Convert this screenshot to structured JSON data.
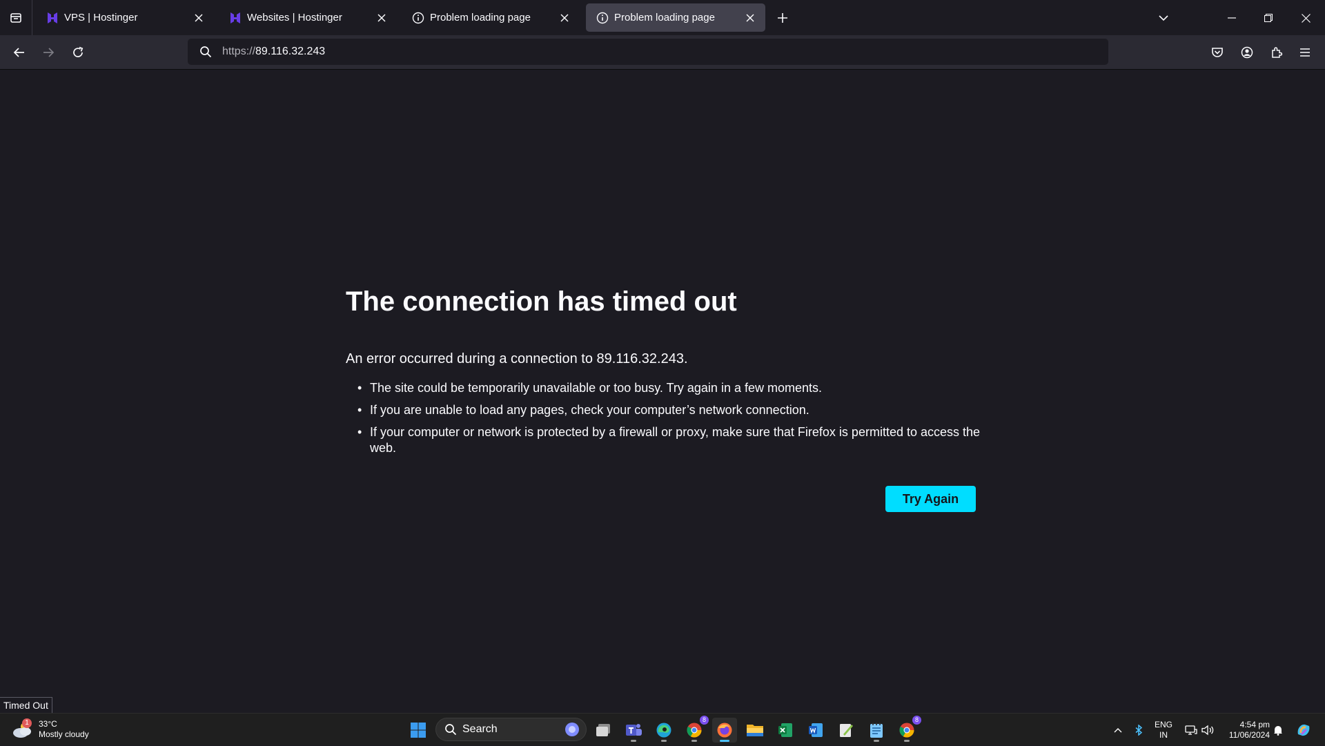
{
  "browser": {
    "tabs": [
      {
        "title": "VPS | Hostinger",
        "favicon": "hostinger-icon",
        "active": false
      },
      {
        "title": "Websites | Hostinger",
        "favicon": "hostinger-icon",
        "active": false
      },
      {
        "title": "Problem loading page",
        "favicon": "info-icon",
        "active": false
      },
      {
        "title": "Problem loading page",
        "favicon": "info-icon",
        "active": true
      }
    ],
    "url_scheme": "https://",
    "url_host": "89.116.32.243"
  },
  "error_page": {
    "title": "The connection has timed out",
    "intro": "An error occurred during a connection to 89.116.32.243.",
    "bullets": [
      "The site could be temporarily unavailable or too busy. Try again in a few moments.",
      "If you are unable to load any pages, check your computer’s network connection.",
      "If your computer or network is protected by a firewall or proxy, make sure that Firefox is permitted to access the web."
    ],
    "button_label": "Try Again"
  },
  "status_tooltip": "Timed Out",
  "taskbar": {
    "weather": {
      "badge": "1",
      "temp": "33°C",
      "condition": "Mostly cloudy"
    },
    "search_placeholder": "Search",
    "apps": [
      "task-view",
      "teams",
      "edge",
      "chrome",
      "firefox",
      "file-explorer",
      "excel",
      "word",
      "notepad-plus",
      "notepad",
      "chrome-profile"
    ],
    "chrome_badge": "8",
    "chrome_profile_badge": "8",
    "language": {
      "line1": "ENG",
      "line2": "IN"
    },
    "clock": {
      "time": "4:54 pm",
      "date": "11/06/2024"
    }
  },
  "colors": {
    "accent_button": "#00ddff",
    "page_bg": "#1c1b22",
    "toolbar_bg": "#2b2a33",
    "active_tab_bg": "#42414d"
  }
}
